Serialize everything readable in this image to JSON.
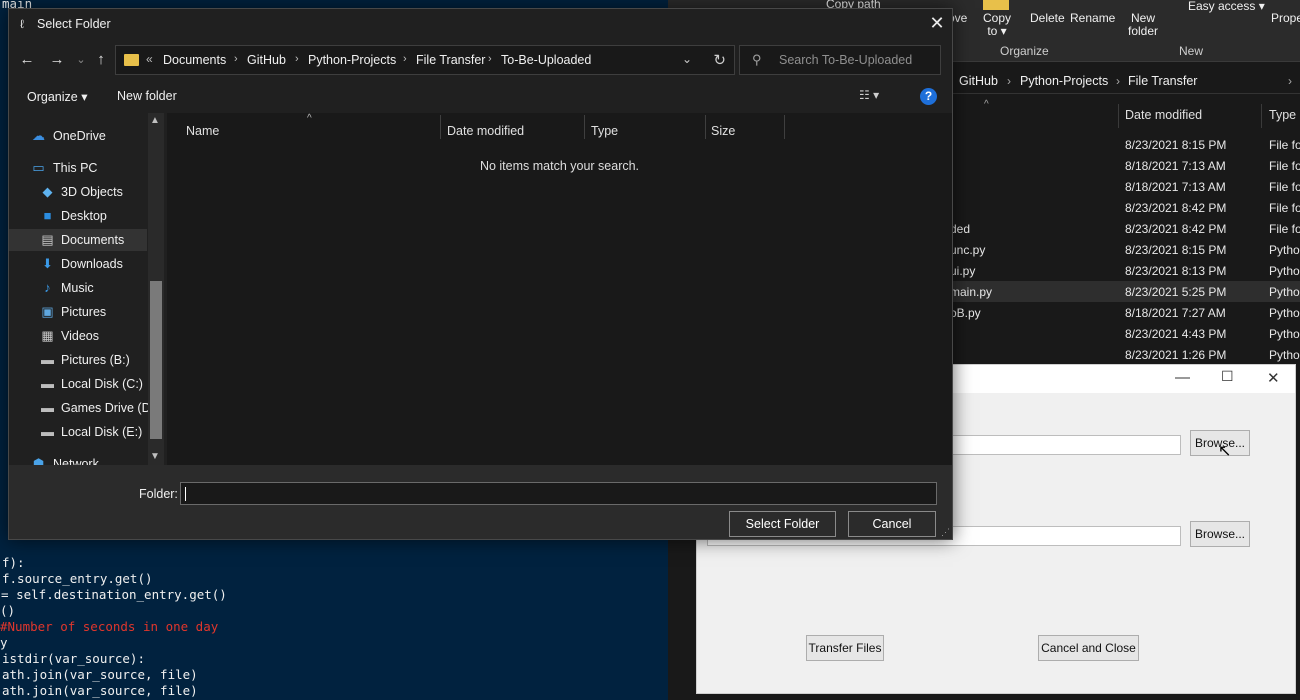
{
  "code": {
    "lines": [
      {
        "text": "main"
      },
      {
        "text": "f):"
      },
      {
        "text": "f.source_entry.get()"
      },
      {
        "text": "  = self.destination_entry.get()"
      },
      {
        "text": "()"
      },
      {
        "text": "#Number of seconds in one day"
      },
      {
        "text": "y"
      },
      {
        "text": "istdir(var_source):"
      },
      {
        "text": "ath.join(var_source, file)"
      },
      {
        "text": "ath.join(var_source, file)"
      }
    ]
  },
  "explorer": {
    "ribbon": {
      "copy_path": "Copy path",
      "move_partial": "ove",
      "copy": "Copy",
      "copy_to": "to ▾",
      "delete": "Delete",
      "rename": "Rename",
      "new_folder": "New\nfolder",
      "easy_access": "Easy access ▾",
      "properties_partial": "Prope",
      "group_organize": "Organize",
      "group_new": "New"
    },
    "address": [
      "GitHub",
      "Python-Projects",
      "File Transfer"
    ],
    "columns": {
      "date_modified": "Date modified",
      "type": "Type"
    },
    "rows": [
      {
        "name": "",
        "date": "8/23/2021 8:15 PM",
        "type": "File fo"
      },
      {
        "name": "",
        "date": "8/18/2021 7:13 AM",
        "type": "File fo"
      },
      {
        "name": "",
        "date": "8/18/2021 7:13 AM",
        "type": "File fo"
      },
      {
        "name": "",
        "date": "8/23/2021 8:42 PM",
        "type": "File fo"
      },
      {
        "name": "ded",
        "date": "8/23/2021 8:42 PM",
        "type": "File fo"
      },
      {
        "name": "unc.py",
        "date": "8/23/2021 8:15 PM",
        "type": "Pytho"
      },
      {
        "name": "ui.py",
        "date": "8/23/2021 8:13 PM",
        "type": "Pytho"
      },
      {
        "name": "main.py",
        "date": "8/23/2021 5:25 PM",
        "type": "Pytho"
      },
      {
        "name": "oB.py",
        "date": "8/18/2021 7:27 AM",
        "type": "Pytho"
      },
      {
        "name": "",
        "date": "8/23/2021 4:43 PM",
        "type": "Pytho"
      },
      {
        "name": "",
        "date": "8/23/2021 1:26 PM",
        "type": "Pytho"
      }
    ]
  },
  "app": {
    "browse1": "Browse...",
    "browse2": "Browse...",
    "transfer": "Transfer Files",
    "cancel_close": "Cancel and Close"
  },
  "dialog": {
    "title": "Select Folder",
    "close": "✕",
    "path": [
      "Documents",
      "GitHub",
      "Python-Projects",
      "File Transfer",
      "To-Be-Uploaded"
    ],
    "path_prefix": "«",
    "search_placeholder": "Search To-Be-Uploaded",
    "toolbar": {
      "organize": "Organize ▾",
      "new_folder": "New folder"
    },
    "nav_items": [
      {
        "label": "OneDrive",
        "icon": "☁",
        "color": "#3b8ee0"
      },
      {
        "label": "This PC",
        "icon": "🖥",
        "color": "#4aa3e8"
      },
      {
        "label": "3D Objects",
        "icon": "◆",
        "color": "#5fb3f0"
      },
      {
        "label": "Desktop",
        "icon": "■",
        "color": "#2b8de0"
      },
      {
        "label": "Documents",
        "icon": "▤",
        "color": "#c9c9c9"
      },
      {
        "label": "Downloads",
        "icon": "⬇",
        "color": "#3b9ae8"
      },
      {
        "label": "Music",
        "icon": "♪",
        "color": "#3b9ae8"
      },
      {
        "label": "Pictures",
        "icon": "▣",
        "color": "#5fa8e0"
      },
      {
        "label": "Videos",
        "icon": "▦",
        "color": "#c9c9c9"
      },
      {
        "label": "Pictures (B:)",
        "icon": "▬",
        "color": "#bdbdbd"
      },
      {
        "label": "Local Disk (C:)",
        "icon": "▬",
        "color": "#bdbdbd"
      },
      {
        "label": "Games Drive (D:)",
        "icon": "▬",
        "color": "#bdbdbd"
      },
      {
        "label": "Local Disk (E:)",
        "icon": "▬",
        "color": "#bdbdbd"
      },
      {
        "label": "Network",
        "icon": "⬢",
        "color": "#4aa3e8"
      }
    ],
    "columns": {
      "name": "Name",
      "date": "Date modified",
      "type": "Type",
      "size": "Size"
    },
    "empty_message": "No items match your search.",
    "folder_label": "Folder:",
    "folder_value": "",
    "select_button": "Select Folder",
    "cancel_button": "Cancel"
  }
}
